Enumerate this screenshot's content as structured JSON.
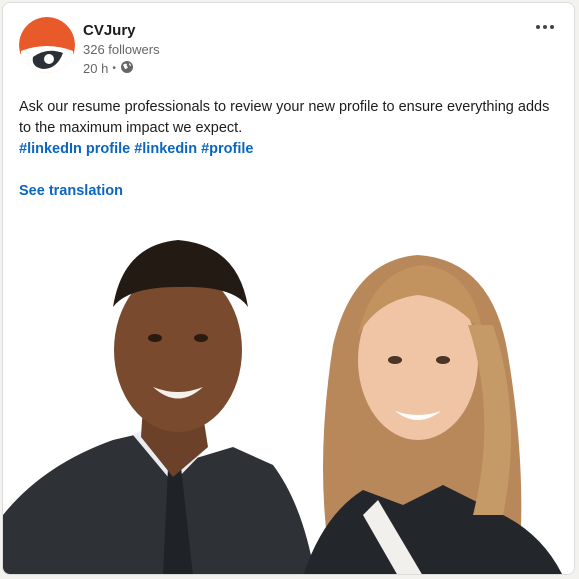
{
  "post": {
    "author": "CVJury",
    "followers": "326 followers",
    "time": "20 h",
    "dot": "•",
    "text": "Ask our resume professionals to review your new profile to ensure everything adds to the maximum impact we expect.",
    "hashtags": [
      "#linkedIn profile",
      "#linkedin",
      "#profile"
    ],
    "see_translation": "See translation"
  },
  "icons": {
    "more": "more-horizontal-icon",
    "visibility": "globe-icon",
    "logo": "cvjury-logo"
  },
  "colors": {
    "link": "#0a66c2",
    "logo_orange": "#e95a2b",
    "logo_dark": "#2b2f36"
  },
  "image": {
    "description_subjects": 2
  }
}
